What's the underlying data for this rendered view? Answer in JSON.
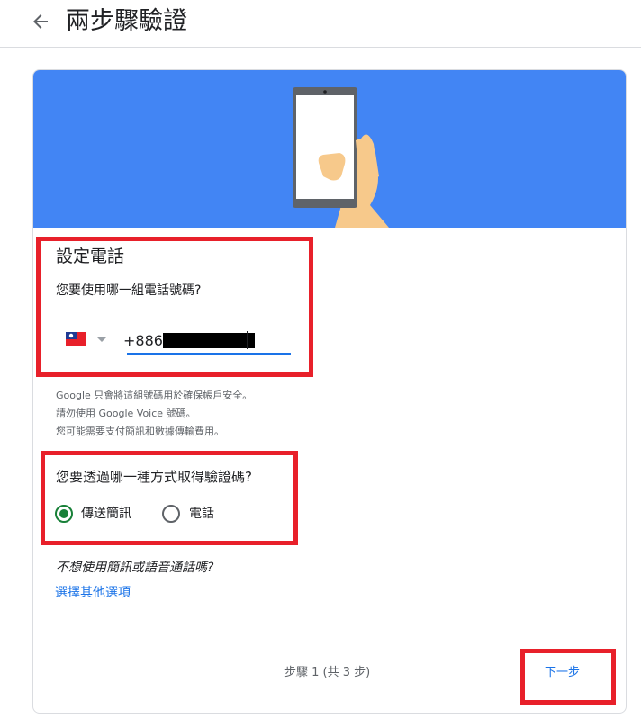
{
  "header": {
    "title": "兩步驟驗證",
    "back_icon": "arrow-left-icon"
  },
  "banner": {
    "background_color": "#4285f4",
    "illustration": "phone-in-hand-illustration"
  },
  "phone_section": {
    "title": "設定電話",
    "question": "您要使用哪一組電話號碼?",
    "country_flag": "taiwan-flag-icon",
    "dropdown_icon": "dropdown-arrow-icon",
    "country_code": "+886",
    "phone_number_redacted": true
  },
  "notes": [
    "Google 只會將這組號碼用於確保帳戶安全。",
    "請勿使用 Google Voice 號碼。",
    "您可能需要支付簡訊和數據傳輸費用。"
  ],
  "method_section": {
    "question": "您要透過哪一種方式取得驗證碼?",
    "options": [
      {
        "label": "傳送簡訊",
        "selected": true
      },
      {
        "label": "電話",
        "selected": false
      }
    ]
  },
  "alternative": {
    "question": "不想使用簡訊或語音通話嗎?",
    "link": "選擇其他選項"
  },
  "footer": {
    "step_text": "步驟 1 (共 3 步)",
    "next_label": "下一步"
  },
  "colors": {
    "accent": "#1a73e8",
    "radio_selected": "#188038",
    "highlight_box": "#e8202a"
  }
}
